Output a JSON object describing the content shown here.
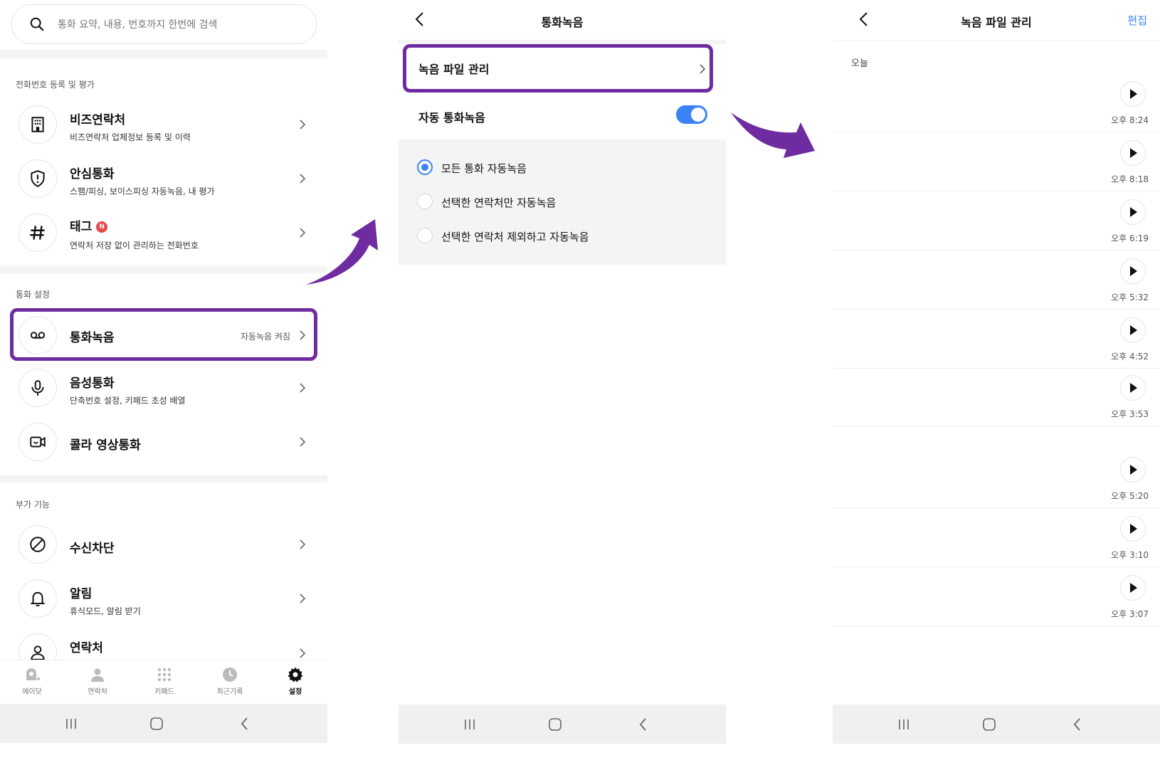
{
  "panel1": {
    "search_placeholder": "통화 요약, 내용, 번호까지 한번에 검색",
    "section1": "전화번호 등록 및 평가",
    "biz": {
      "title": "비즈연락처",
      "sub": "비즈연락처 업체정보 등록 및 이력"
    },
    "safe": {
      "title": "안심통화",
      "sub": "스팸/피싱, 보이스피싱 자동녹음, 내 평가"
    },
    "tag": {
      "title": "태그",
      "badge": "N",
      "sub": "연락처 저장 없이 관리하는 전화번호"
    },
    "section2": "통화 설정",
    "record": {
      "title": "통화녹음",
      "trail": "자동녹음 켜짐"
    },
    "voice": {
      "title": "음성통화",
      "sub": "단축번호 설정, 키패드 초성 배열"
    },
    "video": {
      "title": "콜라 영상통화"
    },
    "section3": "부가 기능",
    "block": {
      "title": "수신차단"
    },
    "alarm": {
      "title": "알림",
      "sub": "휴식모드, 알림 받기"
    },
    "contacts": {
      "title": "연락처"
    },
    "nav": [
      "에이닷",
      "연락처",
      "키패드",
      "최근기록",
      "설정"
    ]
  },
  "panel2": {
    "title": "통화녹음",
    "file_manage": "녹음 파일 관리",
    "auto_record": "자동 통화녹음",
    "auto_record_on": true,
    "options": [
      "모든 통화 자동녹음",
      "선택한 연락처만 자동녹음",
      "선택한 연락처 제외하고 자동녹음"
    ],
    "selected_option": 0
  },
  "panel3": {
    "title": "녹음 파일 관리",
    "edit": "편집",
    "today": "오늘",
    "times": [
      "오후 8:24",
      "오후 8:18",
      "오후 6:19",
      "오후 5:32",
      "오후 4:52",
      "오후 3:53",
      "오후 5:20",
      "오후 3:10",
      "오후 3:07"
    ]
  },
  "colors": {
    "highlight": "#6f2ca0",
    "accent": "#3b82f6",
    "badge": "#e5484d"
  }
}
